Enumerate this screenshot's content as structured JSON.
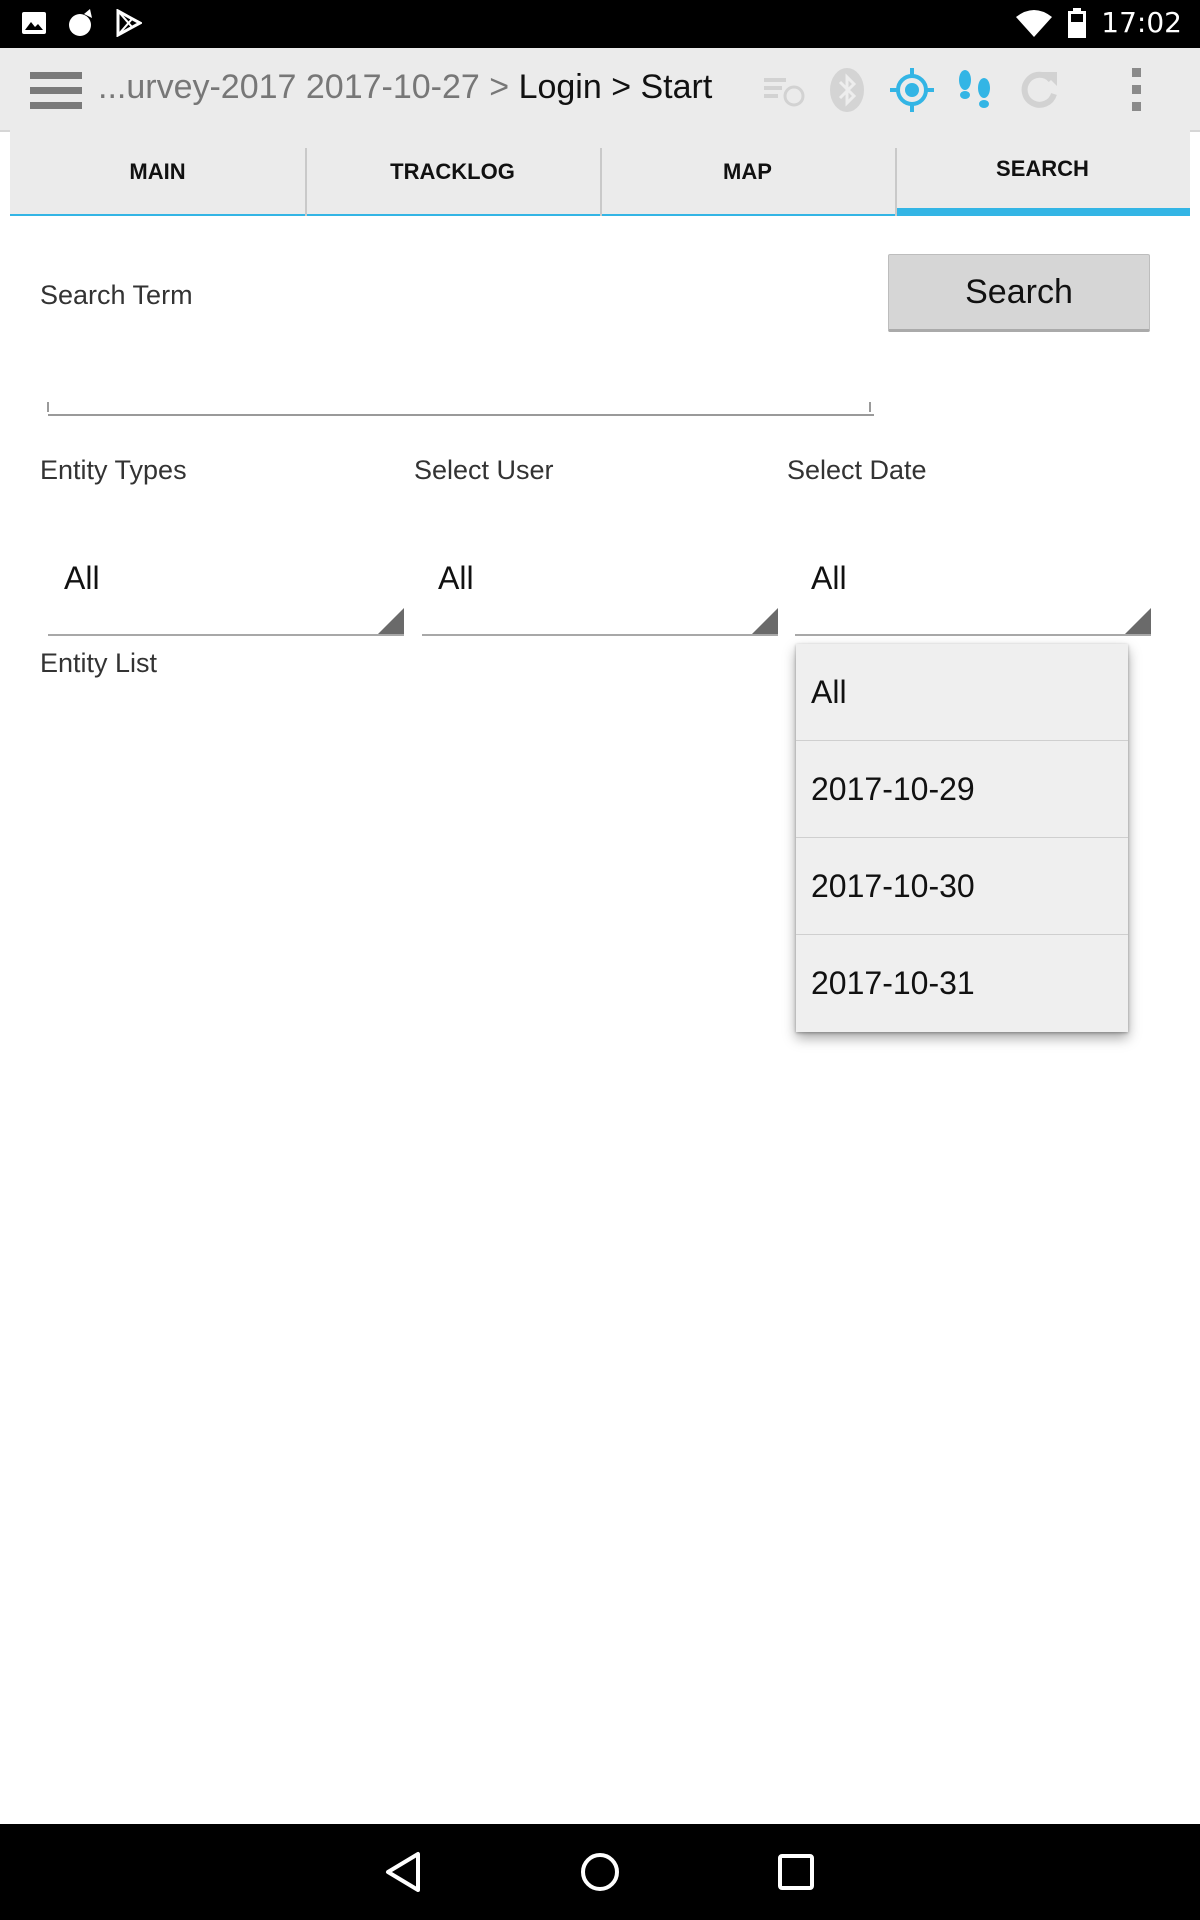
{
  "status_bar": {
    "time": "17:02",
    "icons": [
      "image-notification-icon",
      "cat-app-icon",
      "play-store-icon",
      "wifi-icon",
      "battery-icon"
    ]
  },
  "app_bar": {
    "breadcrumb_prefix": "...urvey-2017 2017-10-27 > ",
    "breadcrumb_current": "Login > Start",
    "tools": [
      "sync-list-icon",
      "bluetooth-icon",
      "gps-locate-icon",
      "footsteps-icon",
      "refresh-icon",
      "overflow-menu-icon"
    ],
    "accent_color": "#33b5e5"
  },
  "tabs": [
    {
      "label": "MAIN",
      "active": false
    },
    {
      "label": "TRACKLOG",
      "active": false
    },
    {
      "label": "MAP",
      "active": false
    },
    {
      "label": "SEARCH",
      "active": true
    }
  ],
  "search": {
    "term_label": "Search Term",
    "button_label": "Search",
    "input_value": "",
    "input_placeholder": ""
  },
  "filters": {
    "entity_types": {
      "label": "Entity Types",
      "value": "All"
    },
    "select_user": {
      "label": "Select User",
      "value": "All"
    },
    "select_date": {
      "label": "Select Date",
      "value": "All"
    }
  },
  "entity_list_label": "Entity List",
  "date_dropdown": {
    "options": [
      "All",
      "2017-10-29",
      "2017-10-30",
      "2017-10-31"
    ]
  },
  "nav_bar": {
    "buttons": [
      "back-icon",
      "home-icon",
      "recents-icon"
    ]
  }
}
